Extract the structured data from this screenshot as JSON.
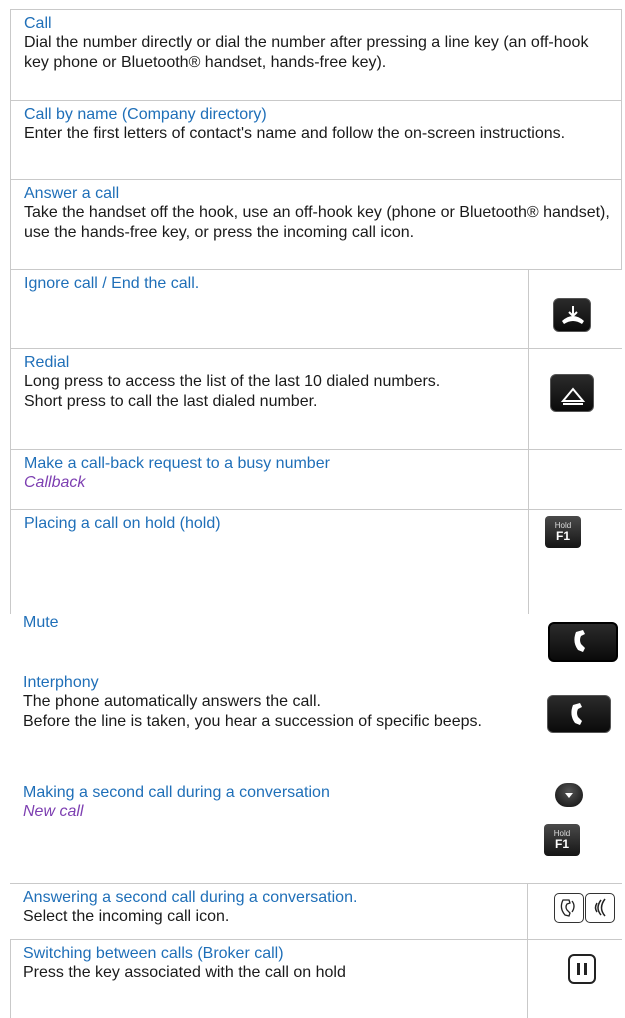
{
  "rows": [
    {
      "title": "Call",
      "desc": "Dial the number directly or dial the number after pressing a line key (an off-hook key phone or Bluetooth® handset, hands-free key)."
    },
    {
      "title": "Call by name (Company directory)",
      "desc": "Enter the first letters of contact's name and follow the on-screen instructions."
    },
    {
      "title": "Answer a call",
      "desc": "Take the handset off the hook, use an off-hook key (phone or Bluetooth® handset), use the hands-free key, or press the incoming call icon."
    },
    {
      "title": "Ignore call / End the call.",
      "icon": "hang-up-key-icon"
    },
    {
      "title": "Redial",
      "desc_lines": [
        "Long press to access the list of the last 10 dialed numbers.",
        "Short press to call the last dialed number."
      ],
      "icon": "redial-key-icon"
    },
    {
      "title": "Make a call-back request to a busy number",
      "option": "Callback"
    },
    {
      "title": "Placing a call on hold (hold)",
      "icon": "hold-f1-key-icon",
      "key_small": "Hold",
      "key_big": "F1"
    },
    {
      "title": "Mute",
      "icon": "mute-key-icon"
    },
    {
      "title": "Interphony",
      "desc_lines": [
        "The phone automatically answers the call.",
        "Before the line is taken, you hear a succession of specific beeps."
      ],
      "icon": "interphony-key-icon"
    },
    {
      "title": "Making a second call during a conversation",
      "option": "New call",
      "icons": [
        "navigator-down-icon",
        "hold-f1-key-icon"
      ],
      "key_small": "Hold",
      "key_big": "F1"
    },
    {
      "title": "Answering a second call during a conversation.",
      "desc": "Select the incoming call icon.",
      "icons": [
        "incoming-call-icon",
        "ringing-call-icon"
      ]
    },
    {
      "title": "Switching between calls (Broker call)",
      "desc": "Press the key associated with the call on hold",
      "icon": "pause-key-icon"
    }
  ]
}
